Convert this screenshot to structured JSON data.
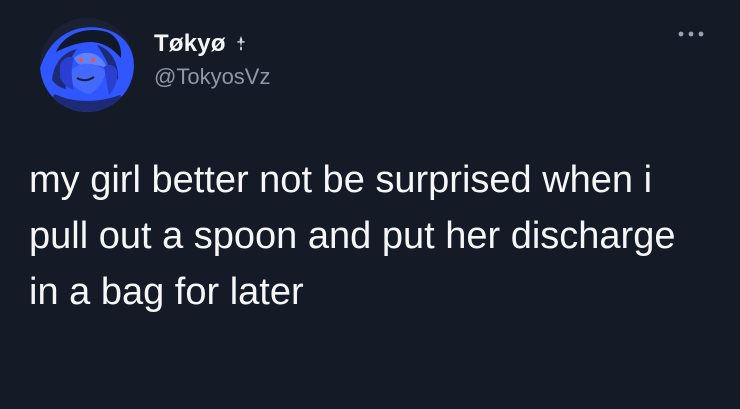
{
  "tweet": {
    "display_name": "Tøkyø",
    "handle": "@TokyosVz",
    "lines": [
      "my girl better not be surprised when i",
      "pull out a spoon and put her discharge",
      "in a bag for later"
    ]
  },
  "icons": {
    "avatar": "anime-avatar",
    "name_decoration": "dagger-icon",
    "menu": "more-icon"
  },
  "colors": {
    "background": "#151a27",
    "text": "#f5f6f8",
    "muted": "#8f98a8",
    "avatar_blue": "#3d61ff"
  }
}
